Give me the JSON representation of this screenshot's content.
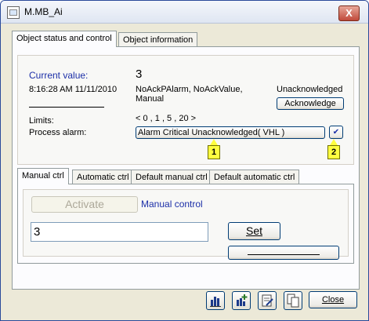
{
  "window": {
    "title": "M.MB_Ai",
    "close_glyph": "X"
  },
  "tabs": {
    "status": "Object status and control",
    "info": "Object information"
  },
  "status": {
    "current_value_label": "Current value:",
    "current_value": "3",
    "timestamp": "8:16:28 AM 11/11/2010",
    "flags": "NoAckPAlarm, NoAckValue,\nManual",
    "ack_state": "Unacknowledged",
    "acknowledge_label": "Acknowledge",
    "limits_label": "Limits:",
    "limits_value": "< 0  ,  1  ,  5  ,  20 >",
    "process_alarm_label": "Process alarm:",
    "process_alarm_value": "Alarm Critical Unacknowledged( VHL )",
    "marker_1": "1",
    "marker_2": "2",
    "check_glyph": "✔"
  },
  "ctrl_tabs": {
    "manual": "Manual ctrl",
    "automatic": "Automatic ctrl",
    "default_manual": "Default manual ctrl",
    "default_automatic": "Default automatic ctrl"
  },
  "manual": {
    "activate_label": "Activate",
    "mode_text": "Manual control",
    "input_value": "3",
    "set_label": "Set"
  },
  "footer": {
    "close_label": "Close",
    "icons": [
      "bar-chart-icon",
      "bar-chart-add-icon",
      "edit-document-icon",
      "copy-document-icon"
    ]
  }
}
